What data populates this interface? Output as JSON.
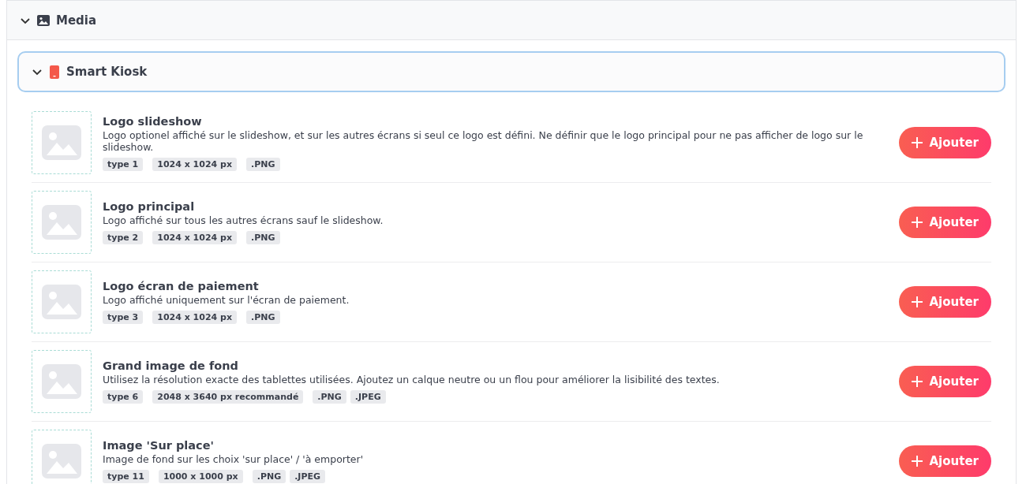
{
  "section": {
    "title": "Media",
    "expanded": true
  },
  "group": {
    "title": "Smart Kiosk",
    "expanded": true
  },
  "items": [
    {
      "title": "Logo slideshow",
      "description": "Logo optionel affiché sur le slideshow, et sur les autres écrans si seul ce logo est défini. Ne définir que le logo principal pour ne pas afficher de logo sur le slideshow.",
      "type": "type 1",
      "size": "1024 x 1024 px",
      "formats": [
        ".PNG"
      ],
      "button": "Ajouter"
    },
    {
      "title": "Logo principal",
      "description": "Logo affiché sur tous les autres écrans sauf le slideshow.",
      "type": "type 2",
      "size": "1024 x 1024 px",
      "formats": [
        ".PNG"
      ],
      "button": "Ajouter"
    },
    {
      "title": "Logo écran de paiement",
      "description": "Logo affiché uniquement sur l'écran de paiement.",
      "type": "type 3",
      "size": "1024 x 1024 px",
      "formats": [
        ".PNG"
      ],
      "button": "Ajouter"
    },
    {
      "title": "Grand image de fond",
      "description": "Utilisez la résolution exacte des tablettes utilisées. Ajoutez un calque neutre ou un flou pour améliorer la lisibilité des textes.",
      "type": "type 6",
      "size": "2048 x 3640 px recommandé",
      "formats": [
        ".PNG",
        ".JPEG"
      ],
      "button": "Ajouter"
    },
    {
      "title": "Image 'Sur place'",
      "description": "Image de fond sur les choix 'sur place' / 'à emporter'",
      "type": "type 11",
      "size": "1000 x 1000 px",
      "formats": [
        ".PNG",
        ".JPEG"
      ],
      "button": "Ajouter"
    }
  ]
}
